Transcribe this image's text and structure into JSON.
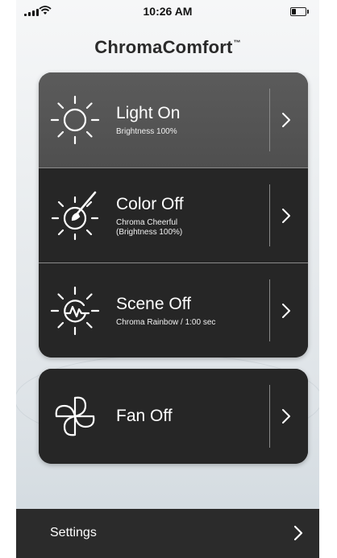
{
  "status_bar": {
    "time": "10:26 AM"
  },
  "app": {
    "title": "ChromaComfort",
    "trademark": "™"
  },
  "controls": [
    {
      "id": "light",
      "title": "Light On",
      "subtitle": "Brightness 100%",
      "icon": "sun-icon",
      "active": true
    },
    {
      "id": "color",
      "title": "Color Off",
      "subtitle_line1": "Chroma Cheerful",
      "subtitle_line2": "(Brightness 100%)",
      "icon": "sun-paintbrush-icon",
      "active": false
    },
    {
      "id": "scene",
      "title": "Scene Off",
      "subtitle": "Chroma Rainbow / 1:00 sec",
      "icon": "sun-wave-icon",
      "active": false
    }
  ],
  "fan": {
    "title": "Fan Off",
    "icon": "fan-icon",
    "active": false
  },
  "bottom_bar": {
    "settings_label": "Settings"
  },
  "colors": {
    "card_dark": "#262626",
    "card_active": "#555555",
    "text_on_card": "#ffffff",
    "divider": "#8a8a8a",
    "bottom_bar": "#2b2b2b"
  }
}
